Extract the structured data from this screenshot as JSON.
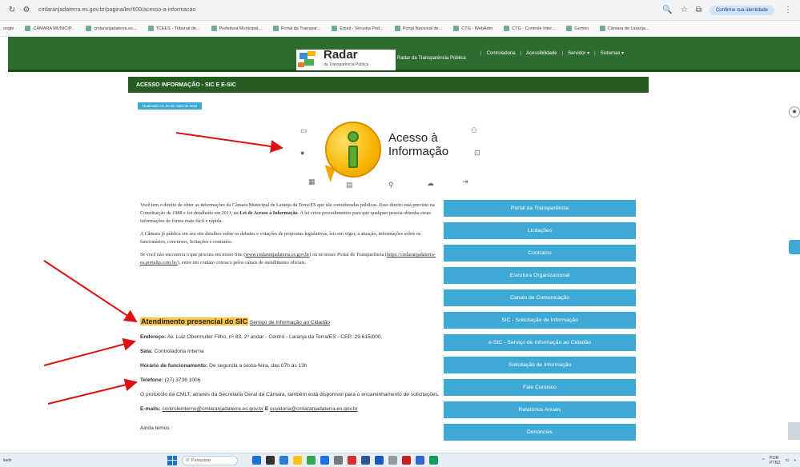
{
  "browser": {
    "url": "cmlaranjadaterra.es.gov.br/pagina/ler/600/acesso-a-informacao",
    "confirm_identity": "Confirme sua identidade",
    "bookmarks": [
      "oogle",
      "CÂMARA MUNICIP...",
      "cmlaranjadaterra.es...",
      "TCEES - Tribunal de...",
      "Prefeitura Municipal...",
      "Portal da Transpar...",
      "Email - Veruska Ped...",
      "Portal Nacional de...",
      "CTG - WebAdm",
      "CTG - Controle Inter...",
      "Gemini",
      "Câmara de Laranja..."
    ]
  },
  "site": {
    "logo_title": "Radar",
    "logo_subtitle": "da Transparência Pública",
    "portal_label": "Radar da Transparência Pública",
    "nav": [
      "Controladoria",
      "Acessibilidade",
      "Servidor ▾",
      "Sistemas ▾"
    ]
  },
  "page": {
    "header": "ACESSO INFORMAÇÃO - SIC E E-SIC",
    "date_badge": "Atualizado em 20 de maio de 2024",
    "ai_title_line1": "Acesso à",
    "ai_title_line2": "Informação",
    "p1_a": "Você tem o direito de obter as informações da Câmara Municipal de Laranja da Terra/ES que são consideradas públicas. Esse direito está previsto na Constituição de 1988 e foi detalhado em 2011, na ",
    "p1_b": "Lei de Acesso à Informação",
    "p1_c": ". A lei criou procedimentos para que qualquer pessoa obtenha essas informações de forma mais fácil e rápida.",
    "p2": "A Câmara já publica em seu site detalhes sobre os debates e votações de propostas legislativas, leis em vigor, a atuação, informações sobre os funcionários, concursos, licitações e contratos.",
    "p3_a": "Se você não encontrou o que procura em nosso Site (",
    "p3_link1": "www.cmlaranjadaterra.es.gov.br",
    "p3_b": ") ou no nosso Portal de Transparência (",
    "p3_link2": "https://cmlaranjadaterra-es.portaltp.com.br/",
    "p3_c": "), entre em contato conosco pelos canais de atendimento oficiais.",
    "sic_heading": "Atendimento presencial do SIC",
    "sic_link": "Serviço de Informação ao Cidadão",
    "endereco_label": "Endereço:",
    "endereco": " Av. Luiz Obermuller Filho, nº 83, 2º andar - Centro - Laranja da Terra/ES - CEP: 29.615/000.",
    "sala_label": "Sala:",
    "sala": " Controladoria Interna",
    "horario_label": "Horário de funcionamento:",
    "horario": " De segunda a sexta-feira, das 07h às 13h",
    "telefone_label": "Telefone:",
    "telefone": " (27) 3736 1006",
    "protocolo": "O protocolo da CMLT, através da Secretaria Geral da Câmara, também está disponível para o encaminhamento de solicitações.",
    "emails_label": "E-mails:",
    "email1": "controleinterno@cmlaranjadaterra.es.gov.br",
    "email_sep": " E ",
    "email2": "ouvidoria@cmlaranjadaterra.es.gov.br",
    "ainda": "Ainda temos :"
  },
  "side_links": [
    "Portal da Transparência",
    "Licitações",
    "Contratos",
    "Estrutura Organizacional",
    "Canais de Comunicação",
    "SIC - Solicitação de Informação",
    "e-SIC - Serviço de Informação ao Cidadão",
    "Solicitação de Informação",
    "Fale Conosco",
    "Relatórios Anuais",
    "Denúncias"
  ],
  "taskbar": {
    "left_text": "ilado",
    "search": "Pesquisar",
    "lang": "POR",
    "lang2": "PTB2"
  }
}
